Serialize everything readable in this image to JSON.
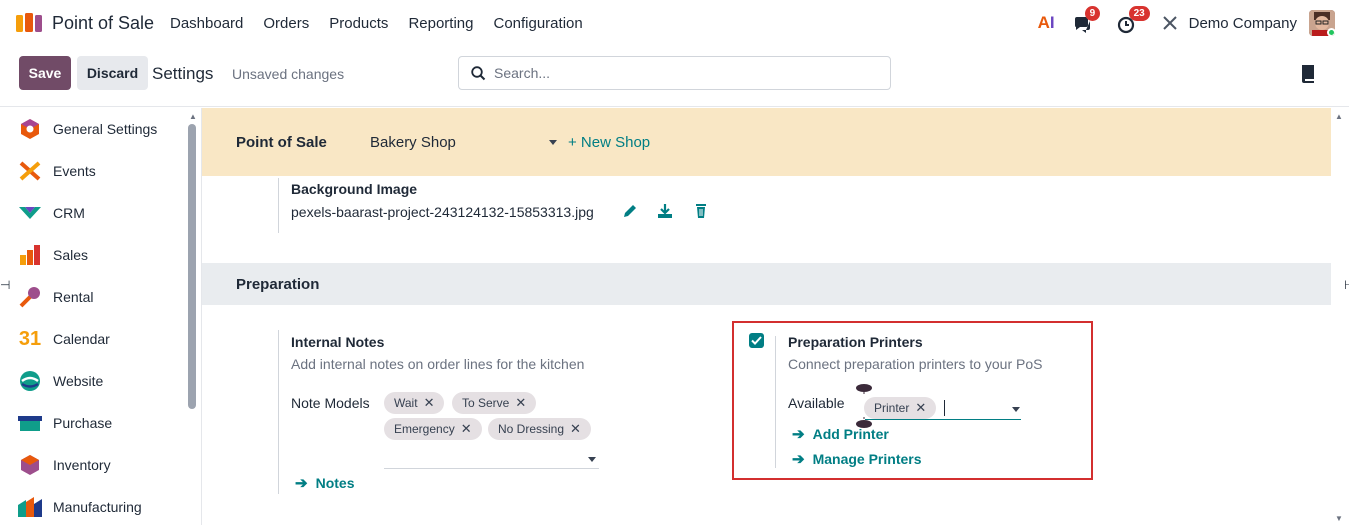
{
  "app": {
    "title": "Point of Sale"
  },
  "menu": [
    "Dashboard",
    "Orders",
    "Products",
    "Reporting",
    "Configuration"
  ],
  "header": {
    "ai_label_a": "A",
    "ai_label_i": "I",
    "messages_count": "9",
    "activities_count": "23",
    "company": "Demo Company"
  },
  "control": {
    "save_label": "Save",
    "discard_label": "Discard",
    "breadcrumb": "Settings",
    "status": "Unsaved changes",
    "search_placeholder": "Search..."
  },
  "sidebar": {
    "items": [
      {
        "label": "General Settings",
        "icon": "general-settings-icon"
      },
      {
        "label": "Events",
        "icon": "events-icon"
      },
      {
        "label": "CRM",
        "icon": "crm-icon"
      },
      {
        "label": "Sales",
        "icon": "sales-icon"
      },
      {
        "label": "Rental",
        "icon": "rental-icon"
      },
      {
        "label": "Calendar",
        "icon": "calendar-icon",
        "glyph": "31"
      },
      {
        "label": "Website",
        "icon": "website-icon"
      },
      {
        "label": "Purchase",
        "icon": "purchase-icon"
      },
      {
        "label": "Inventory",
        "icon": "inventory-icon"
      },
      {
        "label": "Manufacturing",
        "icon": "manufacturing-icon"
      }
    ]
  },
  "band": {
    "title": "Point of Sale",
    "shop": "Bakery Shop",
    "new_shop": "+ New Shop"
  },
  "background_image": {
    "title": "Background Image",
    "file": "pexels-baarast-project-243124132-15853313.jpg"
  },
  "preparation": {
    "section_title": "Preparation",
    "internal_notes": {
      "title": "Internal Notes",
      "description": "Add internal notes on order lines for the kitchen",
      "models_label": "Note Models",
      "tags": [
        "Wait",
        "To Serve",
        "Emergency",
        "No Dressing"
      ],
      "link": "Notes"
    },
    "printers": {
      "checked": true,
      "title": "Preparation Printers",
      "description": "Connect preparation printers to your PoS",
      "available_label": "Available",
      "tag": "Printer",
      "add_link": "Add Printer",
      "manage_link": "Manage Printers"
    }
  },
  "colors": {
    "primary": "#714b67",
    "link": "#017e84",
    "band": "#f9e7c5",
    "highlight": "#d32f2f",
    "badge": "#d8332f"
  }
}
